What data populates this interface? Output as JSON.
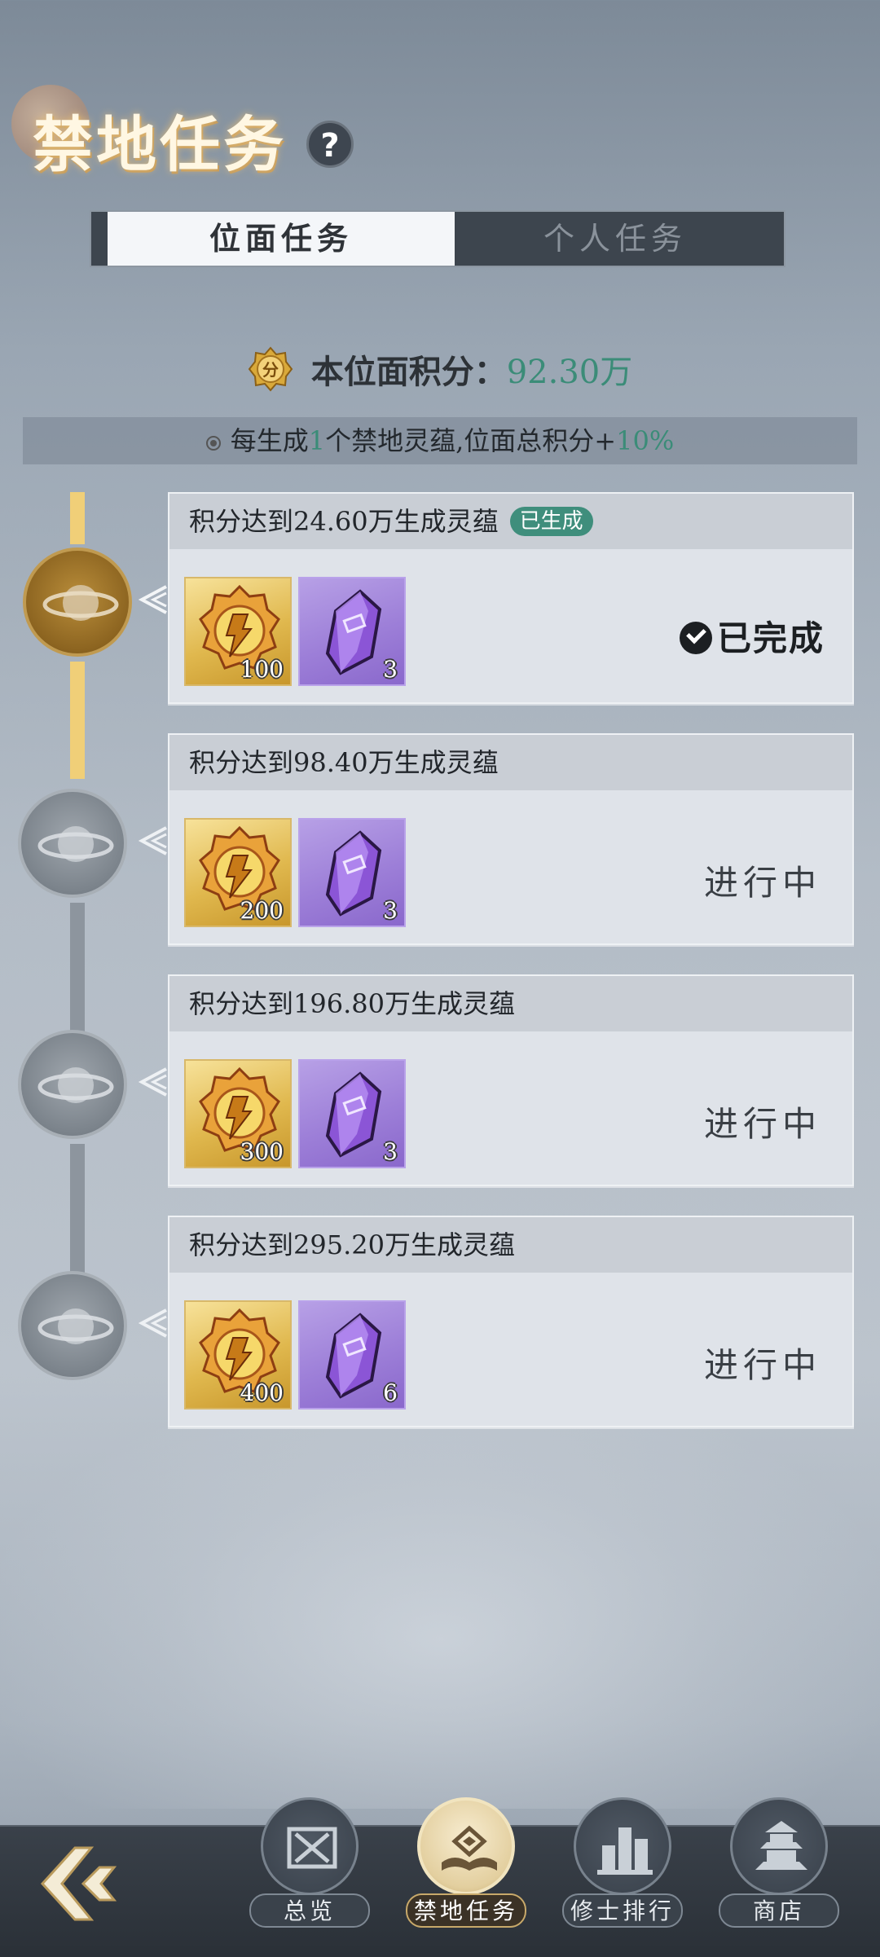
{
  "header": {
    "title": "禁地任务",
    "help_label": "?"
  },
  "tabs": [
    {
      "label": "位面任务",
      "active": true
    },
    {
      "label": "个人任务",
      "active": false
    }
  ],
  "score": {
    "label": "本位面积分：",
    "value": "92.30万"
  },
  "rule": {
    "prefix": "每生成",
    "count": "1",
    "middle": "个禁地灵蕴,位面总积分+",
    "bonus": "10%"
  },
  "tasks": [
    {
      "title": "积分达到24.60万生成灵蕴",
      "badge": "已生成",
      "gold_qty": "100",
      "crystal_qty": "3",
      "status": "已完成",
      "done": true
    },
    {
      "title": "积分达到98.40万生成灵蕴",
      "badge": "",
      "gold_qty": "200",
      "crystal_qty": "3",
      "status": "进行中",
      "done": false
    },
    {
      "title": "积分达到196.80万生成灵蕴",
      "badge": "",
      "gold_qty": "300",
      "crystal_qty": "3",
      "status": "进行中",
      "done": false
    },
    {
      "title": "积分达到295.20万生成灵蕴",
      "badge": "",
      "gold_qty": "400",
      "crystal_qty": "6",
      "status": "进行中",
      "done": false
    }
  ],
  "nav": [
    {
      "label": "总览",
      "icon": "scroll-swords-icon",
      "active": false
    },
    {
      "label": "禁地任务",
      "icon": "book-icon",
      "active": true
    },
    {
      "label": "修士排行",
      "icon": "ranking-icon",
      "active": false
    },
    {
      "label": "商店",
      "icon": "pagoda-icon",
      "active": false
    }
  ],
  "colors": {
    "accent_green": "#3b8c78",
    "gold": "#f0cf78",
    "badge": "#3f8e7c"
  }
}
